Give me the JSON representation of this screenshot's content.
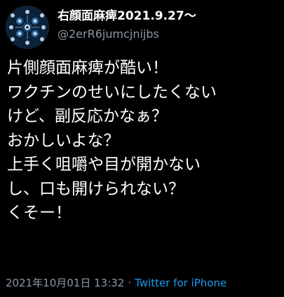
{
  "author": {
    "display_name": "右顔面麻痺2021.9.27〜",
    "handle": "@2erR6jumcjnijbs",
    "avatar_icon": "avatar-pattern-icon"
  },
  "tweet": {
    "lines": [
      "片側顔面麻痺が酷い！",
      "ワクチンのせいにしたくない",
      "けど、副反応かなぁ？",
      "おかしいよな？",
      "上手く咀嚼や目が開かない",
      "し、口も開けられない？",
      "くそー！"
    ]
  },
  "meta": {
    "timestamp": "2021年10月01日 13:32",
    "separator": "·",
    "source": "Twitter for iPhone"
  },
  "colors": {
    "background": "#000000",
    "text": "#ffffff",
    "secondary": "#8b98a5",
    "link": "#1d9bf0"
  }
}
